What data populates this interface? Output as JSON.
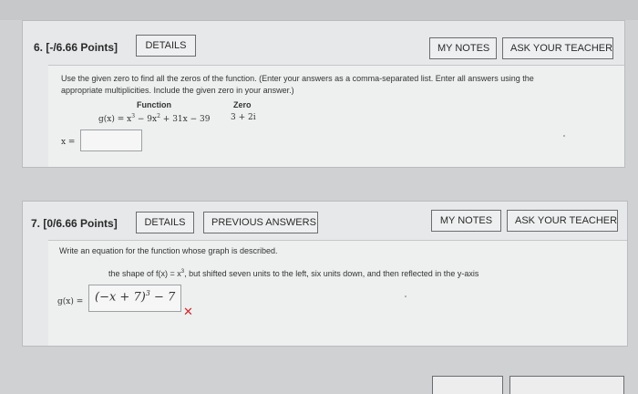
{
  "q6": {
    "title": "6.  [-/6.66 Points]",
    "details_label": "DETAILS",
    "my_notes_label": "MY NOTES",
    "ask_teacher_label": "ASK YOUR TEACHER",
    "instructions_line1": "Use the given zero to find all the zeros of the function. (Enter your answers as a comma-separated list. Enter all answers using the",
    "instructions_line2": "appropriate multiplicities. Include the given zero in your answer.)",
    "function_header": "Function",
    "zero_header": "Zero",
    "function_lhs": "g(x) = x",
    "function_rest": " − 9x",
    "function_tail": " + 31x − 39",
    "exp3": "3",
    "exp2": "2",
    "zero_value": "3 + 2i",
    "answer_label": "x =",
    "answer_value": ""
  },
  "q7": {
    "title": "7.  [0/6.66 Points]",
    "details_label": "DETAILS",
    "previous_answers_label": "PREVIOUS ANSWERS",
    "my_notes_label": "MY NOTES",
    "ask_teacher_label": "ASK YOUR TEACHER",
    "instructions": "Write an equation for the function whose graph is described.",
    "description_a": "the shape of f(x) = x",
    "description_exp": "3",
    "description_b": ", but shifted seven units to the left, six units down, and then reflected in the y-axis",
    "answer_label": "g(x) =",
    "answer_base": "(−x + 7)",
    "answer_exp": "3",
    "answer_tail": " − 7",
    "wrong_mark": "✕"
  },
  "colors": {
    "page_background": "#cfd1d3",
    "card_background": "#e7e8e9",
    "panel_background": "#eeefef",
    "error_red": "#d3262c"
  }
}
